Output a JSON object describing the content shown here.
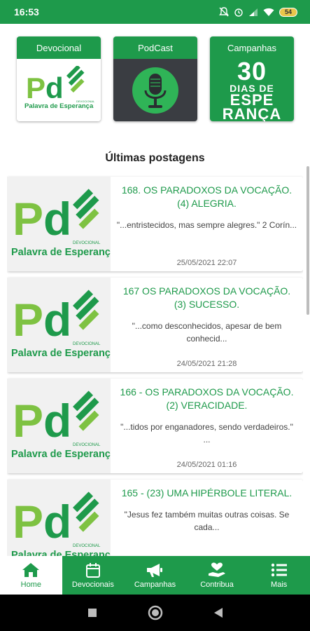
{
  "status_bar": {
    "time": "16:53",
    "battery_level": "54"
  },
  "tiles": [
    {
      "label": "Devocional",
      "logo_text": "Pd",
      "logo_tagline": "Palavra de Esperança",
      "logo_small": "DEVOCIONAL"
    },
    {
      "label": "PodCast",
      "icon": "microphone-icon"
    },
    {
      "label": "Campanhas",
      "line1": "30",
      "line2": "DIAS DE",
      "line3": "ESPE",
      "line4": "RANÇA"
    }
  ],
  "section_title": "Últimas postagens",
  "posts": [
    {
      "title": "168.  OS PARADOXOS DA VOCAÇÃO. (4) ALEGRIA.",
      "excerpt": "\"...entristecidos, mas sempre alegres.\" 2 Corín...",
      "date": "25/05/2021 22:07"
    },
    {
      "title": "167  OS PARADOXOS DA VOCAÇÃO. (3) SUCESSO.",
      "excerpt": "\"...como desconhecidos, apesar de bem conhecid...",
      "date": "24/05/2021 21:28"
    },
    {
      "title": "166 - OS PARADOXOS DA VOCAÇÃO. (2) VERACIDADE.",
      "excerpt": "\"...tidos por enganadores, sendo verdadeiros.\" ...",
      "date": "24/05/2021 01:16"
    },
    {
      "title": "165 - (23) UMA HIPÉRBOLE LITERAL.",
      "excerpt": "\"Jesus fez também muitas outras coisas. Se cada...",
      "date": ""
    }
  ],
  "thumb_logo": {
    "text": "Pd",
    "tagline": "Palavra de Esperança",
    "small": "DEVOCIONAL"
  },
  "bottom_nav": [
    {
      "label": "Home",
      "icon": "home-icon",
      "active": true
    },
    {
      "label": "Devocionais",
      "icon": "calendar-icon",
      "active": false
    },
    {
      "label": "Campanhas",
      "icon": "megaphone-icon",
      "active": false
    },
    {
      "label": "Contribua",
      "icon": "donate-icon",
      "active": false
    },
    {
      "label": "Mais",
      "icon": "menu-list-icon",
      "active": false
    }
  ],
  "colors": {
    "brand_green": "#1e9a4b",
    "light_green": "#7ec242",
    "podcast_bg": "#3a3d42"
  }
}
